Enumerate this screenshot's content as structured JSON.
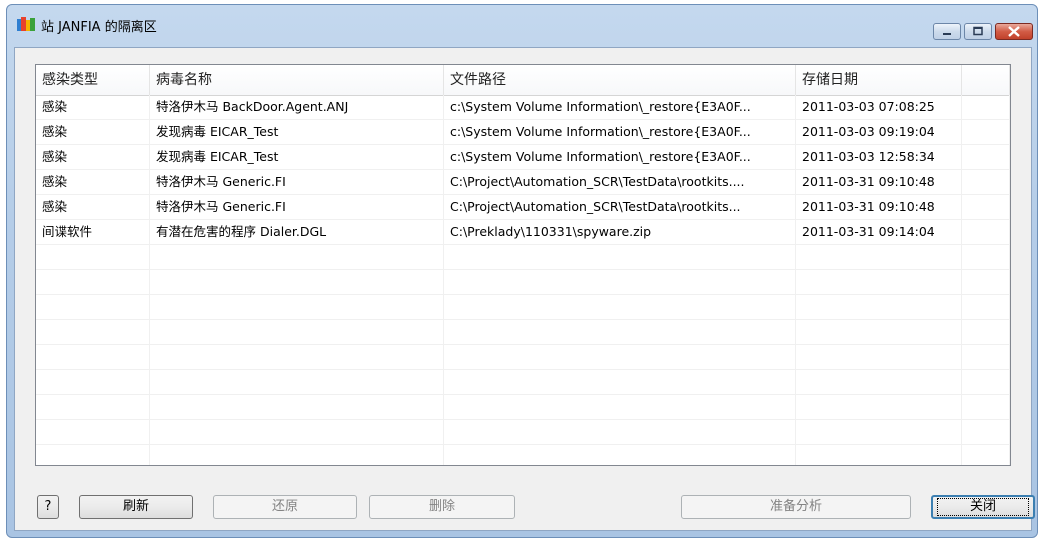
{
  "window": {
    "title": "站 JANFIA 的隔离区"
  },
  "table": {
    "headers": [
      "感染类型",
      "病毒名称",
      "文件路径",
      "存储日期",
      ""
    ],
    "rows": [
      [
        "感染",
        "特洛伊木马 BackDoor.Agent.ANJ",
        "c:\\System Volume Information\\_restore{E3A0F...",
        "2011-03-03 07:08:25"
      ],
      [
        "感染",
        "发现病毒 EICAR_Test",
        "c:\\System Volume Information\\_restore{E3A0F...",
        "2011-03-03 09:19:04"
      ],
      [
        "感染",
        "发现病毒 EICAR_Test",
        "c:\\System Volume Information\\_restore{E3A0F...",
        "2011-03-03 12:58:34"
      ],
      [
        "感染",
        "特洛伊木马 Generic.FI",
        "C:\\Project\\Automation_SCR\\TestData\\rootkits....",
        "2011-03-31 09:10:48"
      ],
      [
        "感染",
        "特洛伊木马 Generic.FI",
        "C:\\Project\\Automation_SCR\\TestData\\rootkits...",
        "2011-03-31 09:10:48"
      ],
      [
        "间谍软件",
        "有潜在危害的程序 Dialer.DGL",
        "C:\\Preklady\\110331\\spyware.zip",
        "2011-03-31 09:14:04"
      ]
    ]
  },
  "buttons": {
    "help": "?",
    "refresh": "刷新",
    "restore": "还原",
    "delete": "删除",
    "analyze": "准备分析",
    "close": "关闭"
  }
}
